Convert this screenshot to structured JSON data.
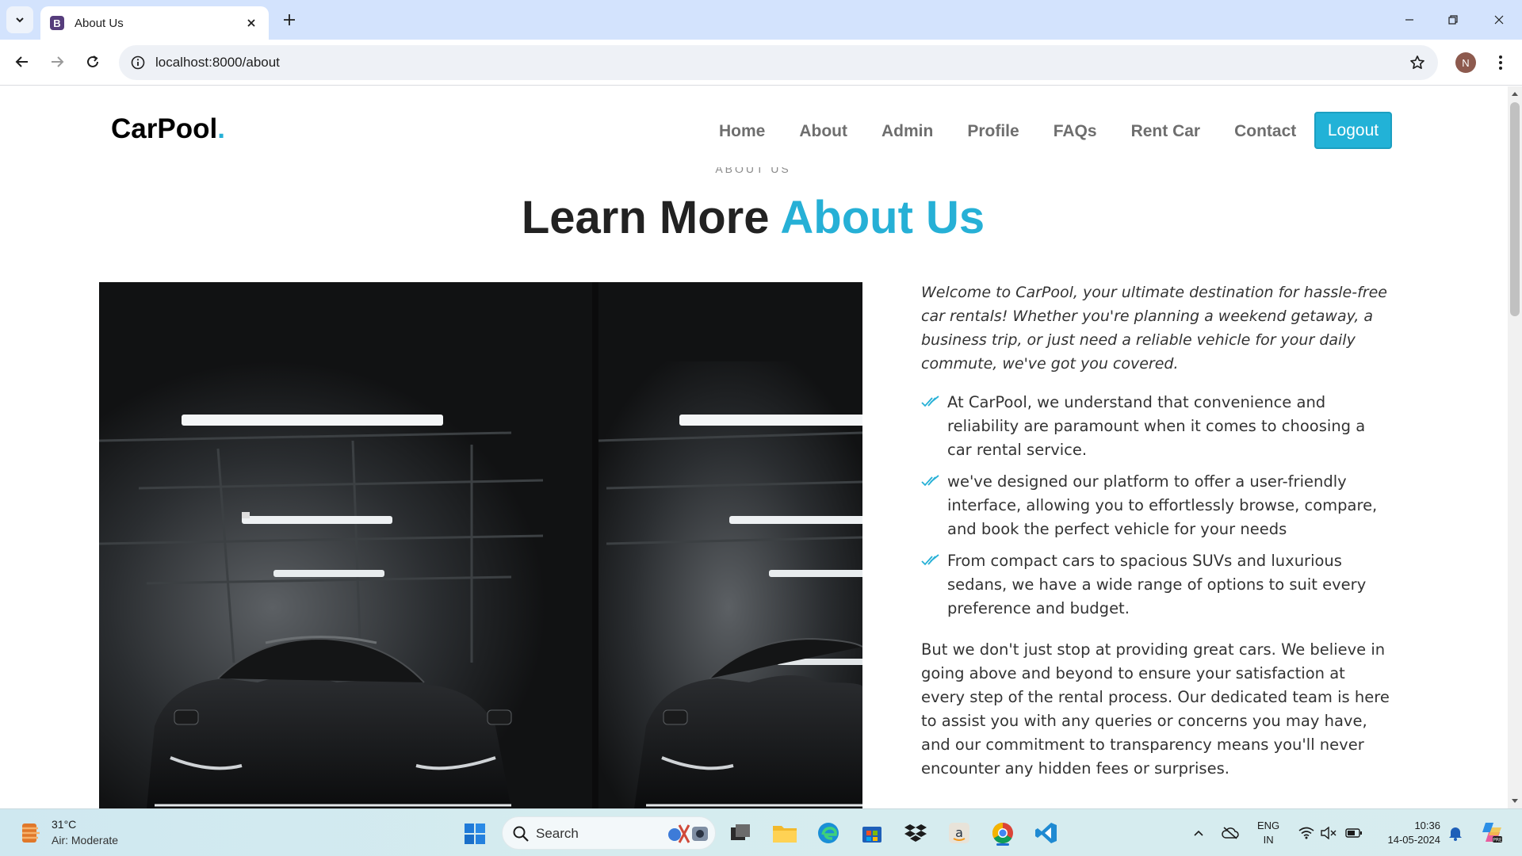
{
  "browser": {
    "tab_title": "About Us",
    "tab_favicon_letter": "B",
    "url": "localhost:8000/about",
    "profile_initial": "N"
  },
  "site": {
    "brand": "CarPool",
    "brand_dot": ".",
    "nav": [
      "Home",
      "About",
      "Admin",
      "Profile",
      "FAQs",
      "Rent Car",
      "Contact"
    ],
    "logout_label": "Logout",
    "accent_color": "#26b0d6"
  },
  "about": {
    "eyebrow": "ABOUT US",
    "title_main": "Learn More ",
    "title_accent": "About Us",
    "image_alt": "Dark parking garage with cars under ceiling lights",
    "intro": "Welcome to CarPool, your ultimate destination for hassle-free car rentals! Whether you're planning a weekend getaway, a business trip, or just need a reliable vehicle for your daily commute, we've got you covered.",
    "features": [
      "At CarPool, we understand that convenience and reliability are paramount when it comes to choosing a car rental service.",
      "we've designed our platform to offer a user-friendly interface, allowing you to effortlessly browse, compare, and book the perfect vehicle for your needs",
      "From compact cars to spacious SUVs and luxurious sedans, we have a wide range of options to suit every preference and budget."
    ],
    "outro": "But we don't just stop at providing great cars. We believe in going above and beyond to ensure your satisfaction at every step of the rental process. Our dedicated team is here to assist you with any queries or concerns you may have, and our commitment to transparency means you'll never encounter any hidden fees or surprises."
  },
  "taskbar": {
    "weather_temp": "31°C",
    "weather_desc": "Air: Moderate",
    "search_label": "Search",
    "lang_line1": "ENG",
    "lang_line2": "IN",
    "time": "10:36",
    "date": "14-05-2024"
  }
}
